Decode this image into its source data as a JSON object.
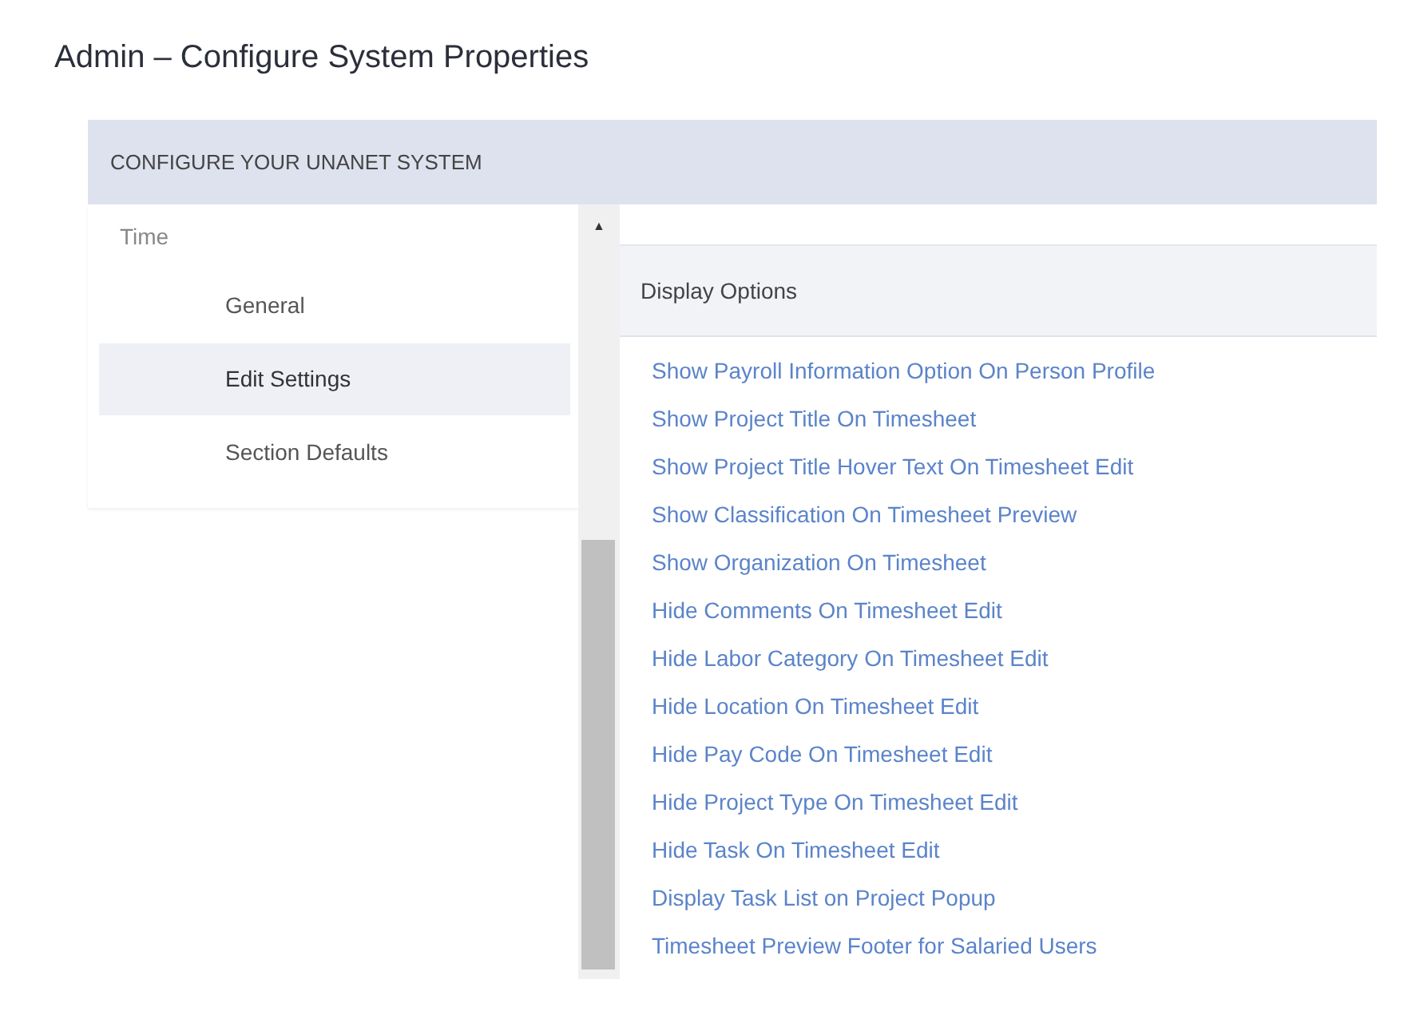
{
  "page_title": "Admin – Configure System Properties",
  "panel": {
    "title": "CONFIGURE YOUR UNANET SYSTEM"
  },
  "sidebar": {
    "items": [
      {
        "label": "Time",
        "selected": false,
        "children": [
          {
            "label": "General",
            "selected": false
          },
          {
            "label": "Edit Settings",
            "selected": true
          },
          {
            "label": "Section Defaults",
            "selected": false
          }
        ]
      }
    ]
  },
  "scrollbar": {
    "up_arrow": "▲"
  },
  "section": {
    "title": "Display Options",
    "links": [
      "Show Payroll Information Option On Person Profile",
      "Show Project Title On Timesheet",
      "Show Project Title Hover Text On Timesheet Edit",
      "Show Classification On Timesheet Preview",
      "Show Organization On Timesheet",
      "Hide Comments On Timesheet Edit",
      "Hide Labor Category On Timesheet Edit",
      "Hide Location On Timesheet Edit",
      "Hide Pay Code On Timesheet Edit",
      "Hide Project Type On Timesheet Edit",
      "Hide Task On Timesheet Edit",
      "Display Task List on Project Popup",
      "Timesheet Preview Footer for Salaried Users"
    ]
  }
}
